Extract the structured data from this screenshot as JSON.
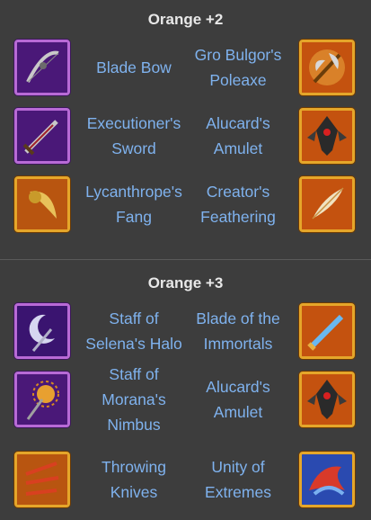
{
  "sections": [
    {
      "title": "Orange +2",
      "rows": [
        {
          "left": {
            "name": "Blade Bow",
            "rarity": "purple",
            "icon": "bow-icon"
          },
          "right": {
            "name": "Gro Bulgor's\nPoleaxe",
            "rarity": "orange",
            "icon": "poleaxe-icon"
          }
        },
        {
          "left": {
            "name": "Executioner's\nSword",
            "rarity": "purple",
            "icon": "sword-icon"
          },
          "right": {
            "name": "Alucard's\nAmulet",
            "rarity": "orange",
            "icon": "amulet-icon"
          }
        },
        {
          "left": {
            "name": "Lycanthrope's\nFang",
            "rarity": "orange",
            "icon": "fang-icon"
          },
          "right": {
            "name": "Creator's\nFeathering",
            "rarity": "orange",
            "icon": "feather-icon"
          }
        }
      ]
    },
    {
      "title": "Orange +3",
      "rows": [
        {
          "left": {
            "name": "Staff of\nSelena's Halo",
            "rarity": "purple",
            "icon": "moon-staff-icon"
          },
          "right": {
            "name": "Blade of the\nImmortals",
            "rarity": "orange",
            "icon": "blade-icon"
          }
        },
        {
          "left": {
            "name": "Staff of\nMorana's\nNimbus",
            "rarity": "purple",
            "icon": "sun-staff-icon"
          },
          "right": {
            "name": "Alucard's\nAmulet",
            "rarity": "orange",
            "icon": "amulet-icon"
          }
        },
        {
          "left": {
            "name": "Throwing\nKnives",
            "rarity": "orange",
            "icon": "knives-icon"
          },
          "right": {
            "name": "Unity of\nExtremes",
            "rarity": "orange",
            "icon": "dragon-icon"
          }
        }
      ]
    }
  ],
  "colors": {
    "background": "#3d3d3d",
    "item_text": "#7fb2ee",
    "title_text": "#e8e8e8",
    "purple_frame": "#b86ad6",
    "orange_frame": "#e5a62a"
  }
}
